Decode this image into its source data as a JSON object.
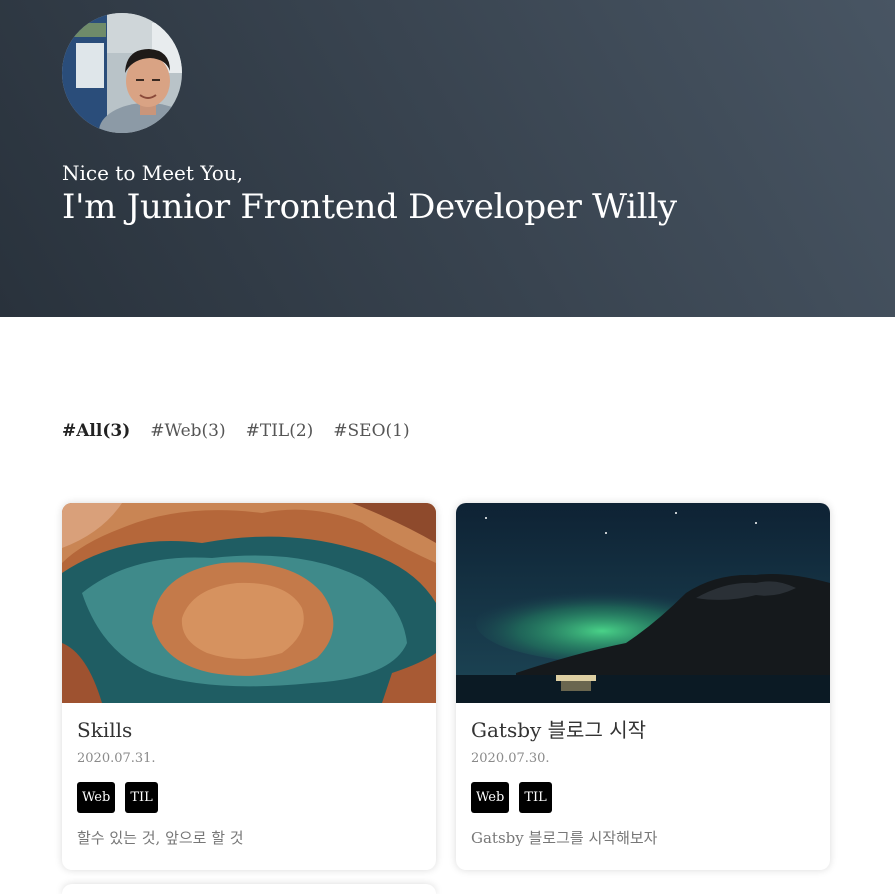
{
  "hero": {
    "greeting": "Nice to Meet You,",
    "title": "I'm Junior Frontend Developer Willy",
    "gradient_start": "#29323c",
    "gradient_end": "#485563"
  },
  "categories": [
    {
      "label": "#All(3)",
      "active": true
    },
    {
      "label": "#Web(3)",
      "active": false
    },
    {
      "label": "#TIL(2)",
      "active": false
    },
    {
      "label": "#SEO(1)",
      "active": false
    }
  ],
  "posts": [
    {
      "title": "Skills",
      "date": "2020.07.31.",
      "tags": [
        "Web",
        "TIL"
      ],
      "summary": "할수 있는 것, 앞으로 할 것",
      "thumbnail": "canyon-river-bend"
    },
    {
      "title": "Gatsby 블로그 시작",
      "date": "2020.07.30.",
      "tags": [
        "Web",
        "TIL"
      ],
      "summary": "Gatsby 블로그를 시작해보자",
      "thumbnail": "aurora-mountains-lake"
    }
  ]
}
